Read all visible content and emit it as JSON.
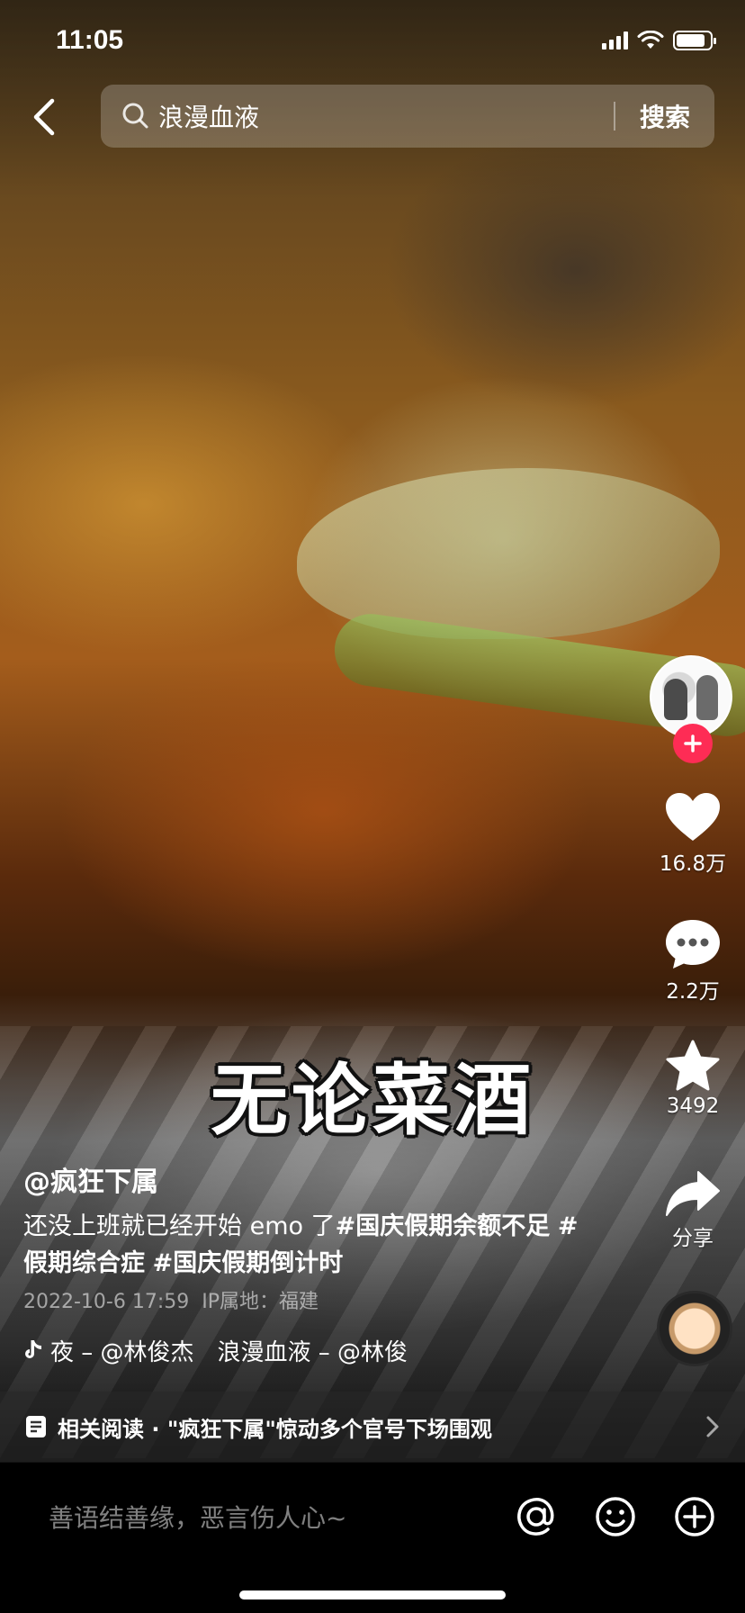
{
  "status_bar": {
    "time": "11:05",
    "battery_level": 0.85
  },
  "search": {
    "query": "浪漫血液",
    "button_label": "搜索"
  },
  "video": {
    "caption_text": "无论菜酒"
  },
  "actions": {
    "likes": "16.8万",
    "comments": "2.2万",
    "favorites": "3492",
    "share": "分享"
  },
  "post": {
    "author": "@疯狂下属",
    "description_text": "还没上班就已经开始 emo 了",
    "tags": [
      "#国庆假期余额不足",
      "#假期综合症",
      "#国庆假期倒计时"
    ],
    "timestamp": "2022-10-6 17:59",
    "ip_location": "IP属地：福建"
  },
  "music": {
    "ticker": "夜 – @林俊杰　浪漫血液 – @林俊"
  },
  "related": {
    "label": "相关阅读 · \"疯狂下属\"惊动多个官号下场围观"
  },
  "comment": {
    "placeholder": "善语结善缘，恶言伤人心~"
  },
  "colors": {
    "follow_accent": "#fe2c55",
    "comment_bar_bg": "#000000"
  }
}
